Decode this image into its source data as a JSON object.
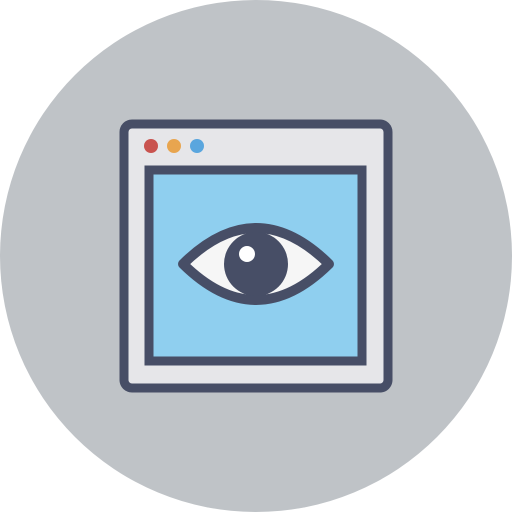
{
  "icon": {
    "name": "browser-window-eye",
    "colors": {
      "background_circle": "#bfc3c7",
      "outline": "#474e66",
      "window_fill": "#e6e6e9",
      "content_fill": "#8fcfef",
      "eye_white": "#f6f6f6",
      "pupil": "#474e66",
      "highlight": "#ffffff",
      "dot_red": "#c9534f",
      "dot_orange": "#e8a54f",
      "dot_blue": "#5aa6de"
    },
    "window_controls": [
      "close-dot",
      "minimize-dot",
      "maximize-dot"
    ]
  }
}
